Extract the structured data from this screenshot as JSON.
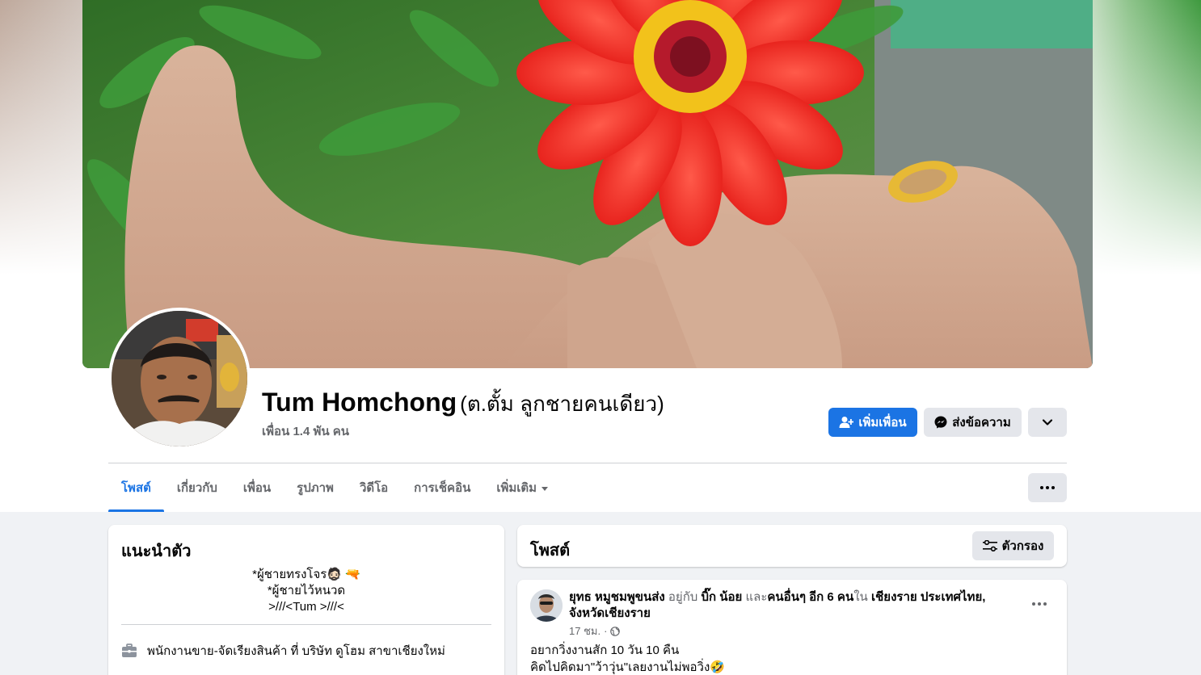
{
  "profile": {
    "name": "Tum Homchong",
    "alternate_name": "(ต.ตั้ม ลูกชายคนเดียว)",
    "friends_count": "เพื่อน 1.4 พัน คน"
  },
  "actions": {
    "add_friend_label": "เพิ่มเพื่อน",
    "message_label": "ส่งข้อความ"
  },
  "tabs": [
    {
      "label": "โพสต์",
      "active": true
    },
    {
      "label": "เกี่ยวกับ"
    },
    {
      "label": "เพื่อน"
    },
    {
      "label": "รูปภาพ"
    },
    {
      "label": "วิดีโอ"
    },
    {
      "label": "การเช็คอิน"
    },
    {
      "label": "เพิ่มเติม"
    }
  ],
  "intro": {
    "title": "แนะนำตัว",
    "bio_lines": [
      "*ผู้ชายทรงโจร🧔🏻 🔫",
      "*ผู้ชายไว้หนวด",
      ">///<Tum >///<"
    ],
    "work": "พนักงานขาย-จัดเรียงสินค้า ที่ บริษัท ดูโฮม สาขาเชียงใหม่"
  },
  "posts_section": {
    "title": "โพสต์",
    "filter_label": "ตัวกรอง"
  },
  "post": {
    "author": "ยุทธ หมูชมพูขนส่ง",
    "with_text": "อยู่กับ",
    "tagged": "บิ๊ก น้อย",
    "and_text": "และ",
    "others": "คนอื่นๆ อีก 6 คน",
    "in_text": "ใน",
    "location": "เชียงราย ประเทศไทย, จังหวัดเชียงราย",
    "time": "17 ชม.",
    "separator": "·",
    "body_lines": [
      "อยากวิ่งงานสัก 10 วัน 10 คืน",
      "คิดไปคิดมา\"ว้าวุ่น\"เลยงานไม่พอวิ่ง🤣"
    ]
  },
  "colors": {
    "accent": "#1b74e4",
    "background": "#f0f2f5",
    "secondary_button": "#e4e6eb",
    "muted_text": "#65676b"
  }
}
